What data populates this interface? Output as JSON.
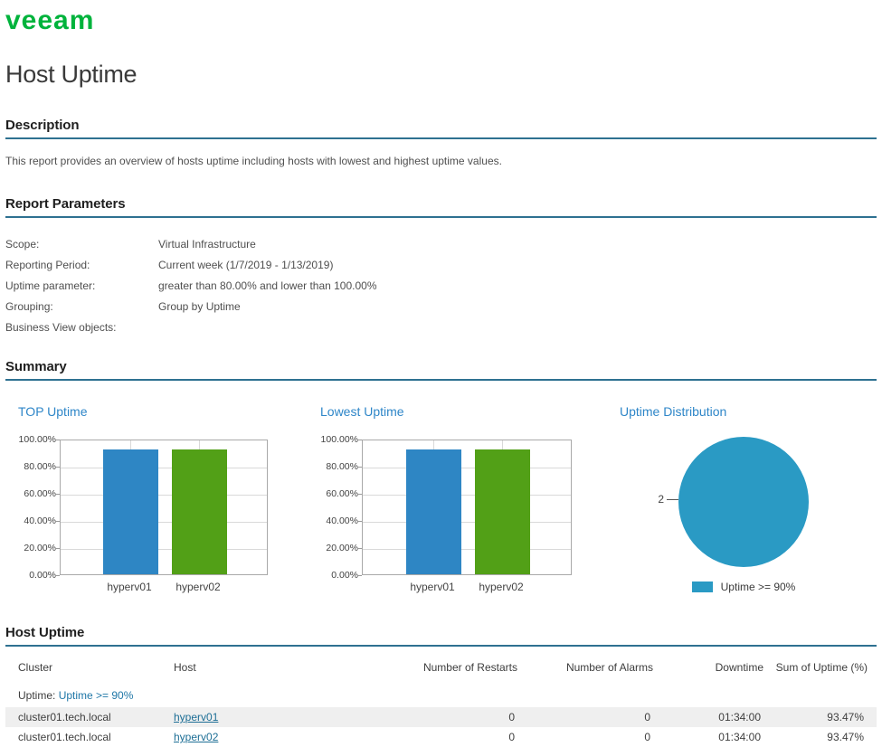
{
  "brand": {
    "logo_text": "veeam"
  },
  "page": {
    "title": "Host Uptime"
  },
  "sections": {
    "description": {
      "heading": "Description",
      "text": "This report provides an overview of hosts uptime including hosts with lowest and highest uptime values."
    },
    "report_parameters": {
      "heading": "Report Parameters",
      "rows": [
        {
          "label": "Scope:",
          "value": "Virtual Infrastructure"
        },
        {
          "label": "Reporting Period:",
          "value": "Current week (1/7/2019 - 1/13/2019)"
        },
        {
          "label": "Uptime parameter:",
          "value": "greater than 80.00% and lower than 100.00%"
        },
        {
          "label": "Grouping:",
          "value": "Group by Uptime"
        },
        {
          "label": "Business View objects:",
          "value": ""
        }
      ]
    },
    "summary": {
      "heading": "Summary"
    },
    "host_uptime": {
      "heading": "Host Uptime"
    }
  },
  "chart_data": [
    {
      "type": "bar",
      "title": "TOP Uptime",
      "categories": [
        "hyperv01",
        "hyperv02"
      ],
      "values": [
        93.47,
        93.47
      ],
      "bar_colors": [
        "#2E86C4",
        "#52A017"
      ],
      "ylabel": "",
      "xlabel": "",
      "ylim": [
        0,
        100
      ],
      "ytick_step": 20,
      "ytick_suffix": "%",
      "grid": true
    },
    {
      "type": "bar",
      "title": "Lowest Uptime",
      "categories": [
        "hyperv01",
        "hyperv02"
      ],
      "values": [
        93.47,
        93.47
      ],
      "bar_colors": [
        "#2E86C4",
        "#52A017"
      ],
      "ylabel": "",
      "xlabel": "",
      "ylim": [
        0,
        100
      ],
      "ytick_step": 20,
      "ytick_suffix": "%",
      "grid": true
    },
    {
      "type": "pie",
      "title": "Uptime Distribution",
      "slices": [
        {
          "label": "Uptime >= 90%",
          "value": 2,
          "color": "#2A9AC4"
        }
      ],
      "callout_label": "2",
      "legend_position": "bottom"
    }
  ],
  "table": {
    "columns": [
      {
        "label": "Cluster",
        "align": "left"
      },
      {
        "label": "Host",
        "align": "left"
      },
      {
        "label": "Number of Restarts",
        "align": "right"
      },
      {
        "label": "Number of Alarms",
        "align": "right"
      },
      {
        "label": "Downtime",
        "align": "right"
      },
      {
        "label": "Sum of Uptime (%)",
        "align": "right"
      }
    ],
    "group_row": {
      "prefix": "Uptime:",
      "value": "Uptime >= 90%"
    },
    "rows": [
      {
        "cluster": "cluster01.tech.local",
        "host": "hyperv01",
        "restarts": "0",
        "alarms": "0",
        "downtime": "01:34:00",
        "uptime": "93.47%"
      },
      {
        "cluster": "cluster01.tech.local",
        "host": "hyperv02",
        "restarts": "0",
        "alarms": "0",
        "downtime": "01:34:00",
        "uptime": "93.47%"
      }
    ]
  },
  "colors": {
    "brand_green": "#00B33C",
    "heading_rule": "#2E7191",
    "chart_title_blue": "#2E86C8",
    "link_blue": "#1E6F96",
    "group_value_blue": "#2178A8",
    "bar_blue": "#2E86C4",
    "bar_green": "#52A017",
    "pie_teal": "#2A9AC4",
    "row_alt_bg": "#EFEFEF"
  }
}
